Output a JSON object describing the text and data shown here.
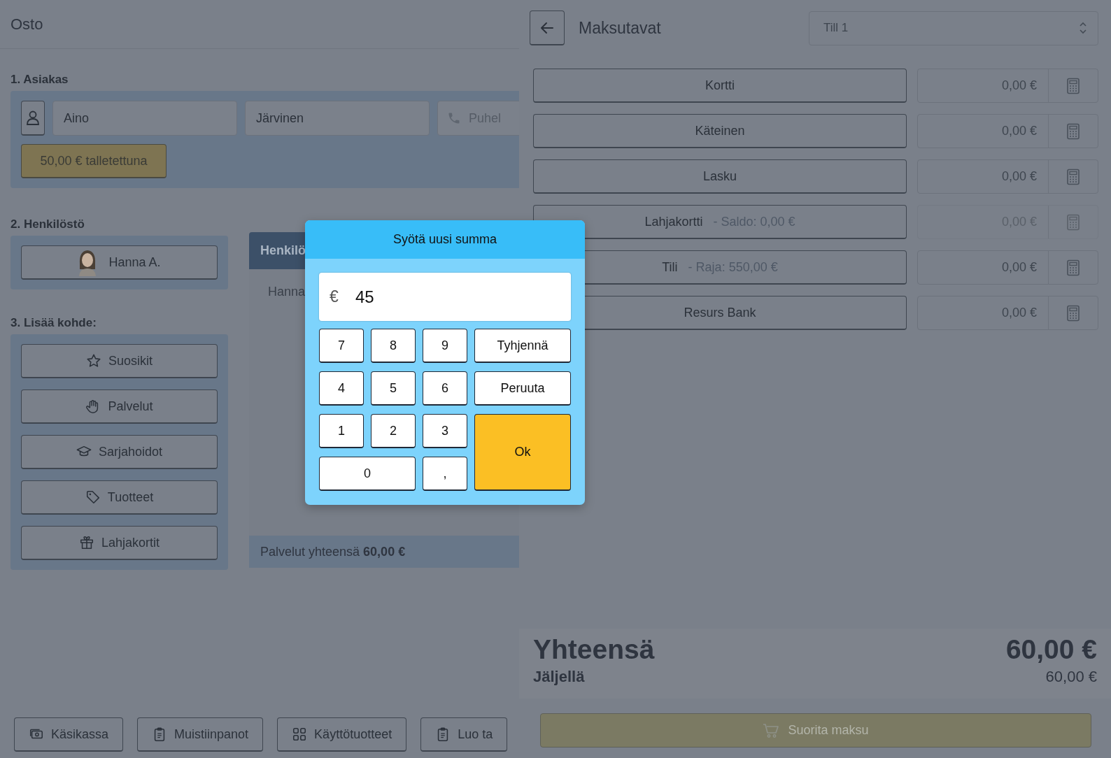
{
  "purchase": {
    "title": "Osto",
    "customer": {
      "heading": "1. Asiakas",
      "first_name": "Aino",
      "last_name": "Järvinen",
      "phone_placeholder": "Puhel",
      "deposit": "50,00 € talletettuna"
    },
    "staff": {
      "heading": "2. Henkilöstö",
      "member": "Hanna A."
    },
    "staff_panel": {
      "header": "Henkilö",
      "row": "Hanna",
      "total_label": "Palvelut yhteensä",
      "total_value": "60,00 €"
    },
    "add_item": {
      "heading": "3. Lisää kohde:",
      "buttons": [
        {
          "label": "Suosikit",
          "kind": "star"
        },
        {
          "label": "Palvelut",
          "kind": "hand"
        },
        {
          "label": "Sarjahoidot",
          "kind": "cap"
        },
        {
          "label": "Tuotteet",
          "kind": "tag"
        },
        {
          "label": "Lahjakortit",
          "kind": "gift"
        }
      ]
    },
    "toolbar": [
      {
        "label": "Käsikassa",
        "kind": "cash"
      },
      {
        "label": "Muistiinpanot",
        "kind": "clipboard"
      },
      {
        "label": "Käyttötuotteet",
        "kind": "grid"
      },
      {
        "label": "Luo ta",
        "kind": "clipboard"
      }
    ]
  },
  "payment": {
    "title": "Maksutavat",
    "till": "Till 1",
    "methods": [
      {
        "name": "Kortti",
        "amount": "0,00 €",
        "disabled": false
      },
      {
        "name": "Käteinen",
        "amount": "0,00 €",
        "disabled": false
      },
      {
        "name": "Lasku",
        "amount": "0,00 €",
        "disabled": false
      },
      {
        "name": "Lahjakortti",
        "detail": "- Saldo: 0,00 €",
        "amount": "0,00 €",
        "disabled": true
      },
      {
        "name": "Tili",
        "detail": "- Raja: 550,00 €",
        "amount": "0,00 €",
        "disabled": false
      },
      {
        "name": "Resurs Bank",
        "amount": "0,00 €",
        "disabled": false
      }
    ],
    "total_label": "Yhteensä",
    "total_value": "60,00 €",
    "remaining_label": "Jäljellä",
    "remaining_value": "60,00 €",
    "pay_button": "Suorita maksu"
  },
  "dialog": {
    "title": "Syötä uusi summa",
    "currency": "€",
    "value": "45",
    "keys": [
      {
        "label": "7",
        "kind": "digit"
      },
      {
        "label": "8",
        "kind": "digit"
      },
      {
        "label": "9",
        "kind": "digit"
      },
      {
        "label": "Tyhjennä",
        "kind": "action"
      },
      {
        "label": "4",
        "kind": "digit"
      },
      {
        "label": "5",
        "kind": "digit"
      },
      {
        "label": "6",
        "kind": "digit"
      },
      {
        "label": "Peruuta",
        "kind": "action"
      },
      {
        "label": "1",
        "kind": "digit"
      },
      {
        "label": "2",
        "kind": "digit"
      },
      {
        "label": "3",
        "kind": "digit"
      },
      {
        "label": "Ok",
        "kind": "ok"
      },
      {
        "label": "0",
        "kind": "wide"
      },
      {
        "label": ",",
        "kind": "digit"
      }
    ]
  }
}
